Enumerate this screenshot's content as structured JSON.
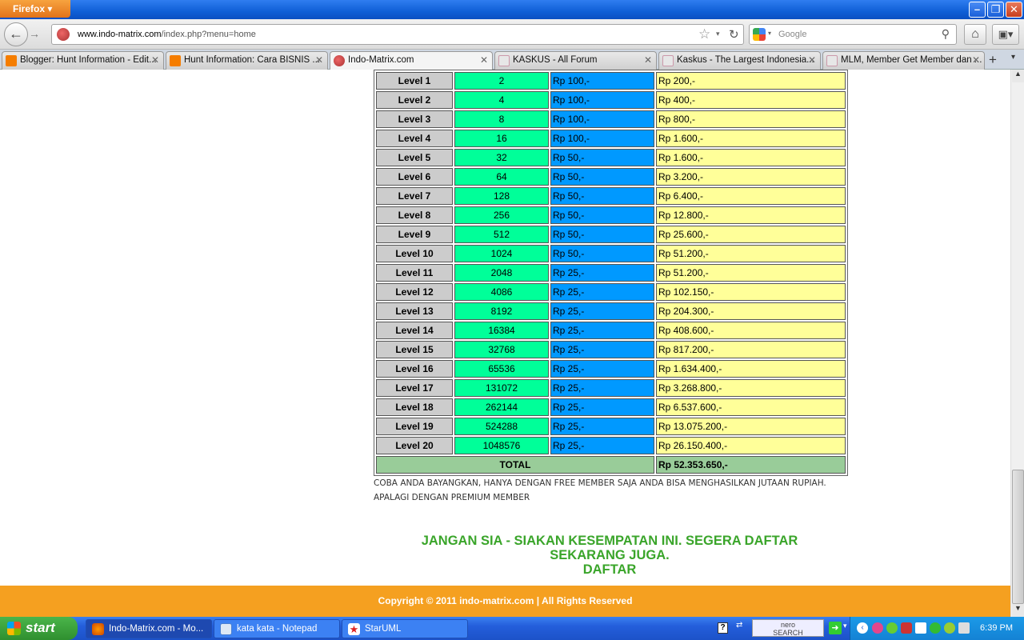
{
  "browser": {
    "menu_label": "Firefox",
    "url_domain": "www.indo-matrix.com",
    "url_path": "/index.php?menu=home",
    "search_placeholder": "Google",
    "tabs": [
      {
        "label": "Blogger: Hunt Information - Edit...",
        "icon": "blogger"
      },
      {
        "label": "Hunt Information: Cara BISNIS ...",
        "icon": "blogger"
      },
      {
        "label": "Indo-Matrix.com",
        "icon": "matrix"
      },
      {
        "label": "KASKUS - All Forum",
        "icon": "kaskus"
      },
      {
        "label": "Kaskus - The Largest Indonesia...",
        "icon": "kaskus"
      },
      {
        "label": "MLM, Member Get Member dan ...",
        "icon": "kaskus"
      }
    ]
  },
  "table": {
    "rows": [
      {
        "level": "Level 1",
        "members": "2",
        "bonus": "Rp 100,-",
        "total": "Rp 200,-"
      },
      {
        "level": "Level 2",
        "members": "4",
        "bonus": "Rp 100,-",
        "total": "Rp 400,-"
      },
      {
        "level": "Level 3",
        "members": "8",
        "bonus": "Rp 100,-",
        "total": "Rp 800,-"
      },
      {
        "level": "Level 4",
        "members": "16",
        "bonus": "Rp 100,-",
        "total": "Rp 1.600,-"
      },
      {
        "level": "Level 5",
        "members": "32",
        "bonus": "Rp 50,-",
        "total": "Rp 1.600,-"
      },
      {
        "level": "Level 6",
        "members": "64",
        "bonus": "Rp 50,-",
        "total": "Rp 3.200,-"
      },
      {
        "level": "Level 7",
        "members": "128",
        "bonus": "Rp 50,-",
        "total": "Rp 6.400,-"
      },
      {
        "level": "Level 8",
        "members": "256",
        "bonus": "Rp 50,-",
        "total": "Rp 12.800,-"
      },
      {
        "level": "Level 9",
        "members": "512",
        "bonus": "Rp 50,-",
        "total": "Rp 25.600,-"
      },
      {
        "level": "Level 10",
        "members": "1024",
        "bonus": "Rp 50,-",
        "total": "Rp 51.200,-"
      },
      {
        "level": "Level 11",
        "members": "2048",
        "bonus": "Rp 25,-",
        "total": "Rp 51.200,-"
      },
      {
        "level": "Level 12",
        "members": "4086",
        "bonus": "Rp 25,-",
        "total": "Rp 102.150,-"
      },
      {
        "level": "Level 13",
        "members": "8192",
        "bonus": "Rp 25,-",
        "total": "Rp 204.300,-"
      },
      {
        "level": "Level 14",
        "members": "16384",
        "bonus": "Rp 25,-",
        "total": "Rp 408.600,-"
      },
      {
        "level": "Level 15",
        "members": "32768",
        "bonus": "Rp 25,-",
        "total": "Rp 817.200,-"
      },
      {
        "level": "Level 16",
        "members": "65536",
        "bonus": "Rp 25,-",
        "total": "Rp 1.634.400,-"
      },
      {
        "level": "Level 17",
        "members": "131072",
        "bonus": "Rp 25,-",
        "total": "Rp 3.268.800,-"
      },
      {
        "level": "Level 18",
        "members": "262144",
        "bonus": "Rp 25,-",
        "total": "Rp 6.537.600,-"
      },
      {
        "level": "Level 19",
        "members": "524288",
        "bonus": "Rp 25,-",
        "total": "Rp 13.075.200,-"
      },
      {
        "level": "Level 20",
        "members": "1048576",
        "bonus": "Rp 25,-",
        "total": "Rp 26.150.400,-"
      }
    ],
    "total_label": "TOTAL",
    "total_value": "Rp 52.353.650,-",
    "colors": {
      "level": "#cccccc",
      "members": "#00ff99",
      "bonus": "#0099ff",
      "total": "#ffff99",
      "summary": "#99cc99"
    }
  },
  "page": {
    "note_line1": "COBA ANDA BAYANGKAN, HANYA DENGAN FREE MEMBER SAJA ANDA BISA MENGHASILKAN JUTAAN RUPIAH.",
    "note_line2": "APALAGI DENGAN PREMIUM MEMBER",
    "cta_line1": "JANGAN SIA - SIAKAN KESEMPATAN INI. SEGERA DAFTAR",
    "cta_line2": "SEKARANG JUGA.",
    "cta_link": "DAFTAR",
    "cta_color": "#3aa52a",
    "footer": "Copyright © 2011 indo-matrix.com | All Rights Reserved",
    "footer_color": "#f5a020"
  },
  "taskbar": {
    "start_label": "start",
    "tasks": [
      {
        "label": "Indo-Matrix.com - Mo...",
        "icon": "firefox"
      },
      {
        "label": "kata kata - Notepad",
        "icon": "notepad"
      },
      {
        "label": "StarUML",
        "icon": "staruml"
      }
    ],
    "nero_label_1": "nero",
    "nero_label_2": "SEARCH",
    "clock": "6:39 PM"
  }
}
